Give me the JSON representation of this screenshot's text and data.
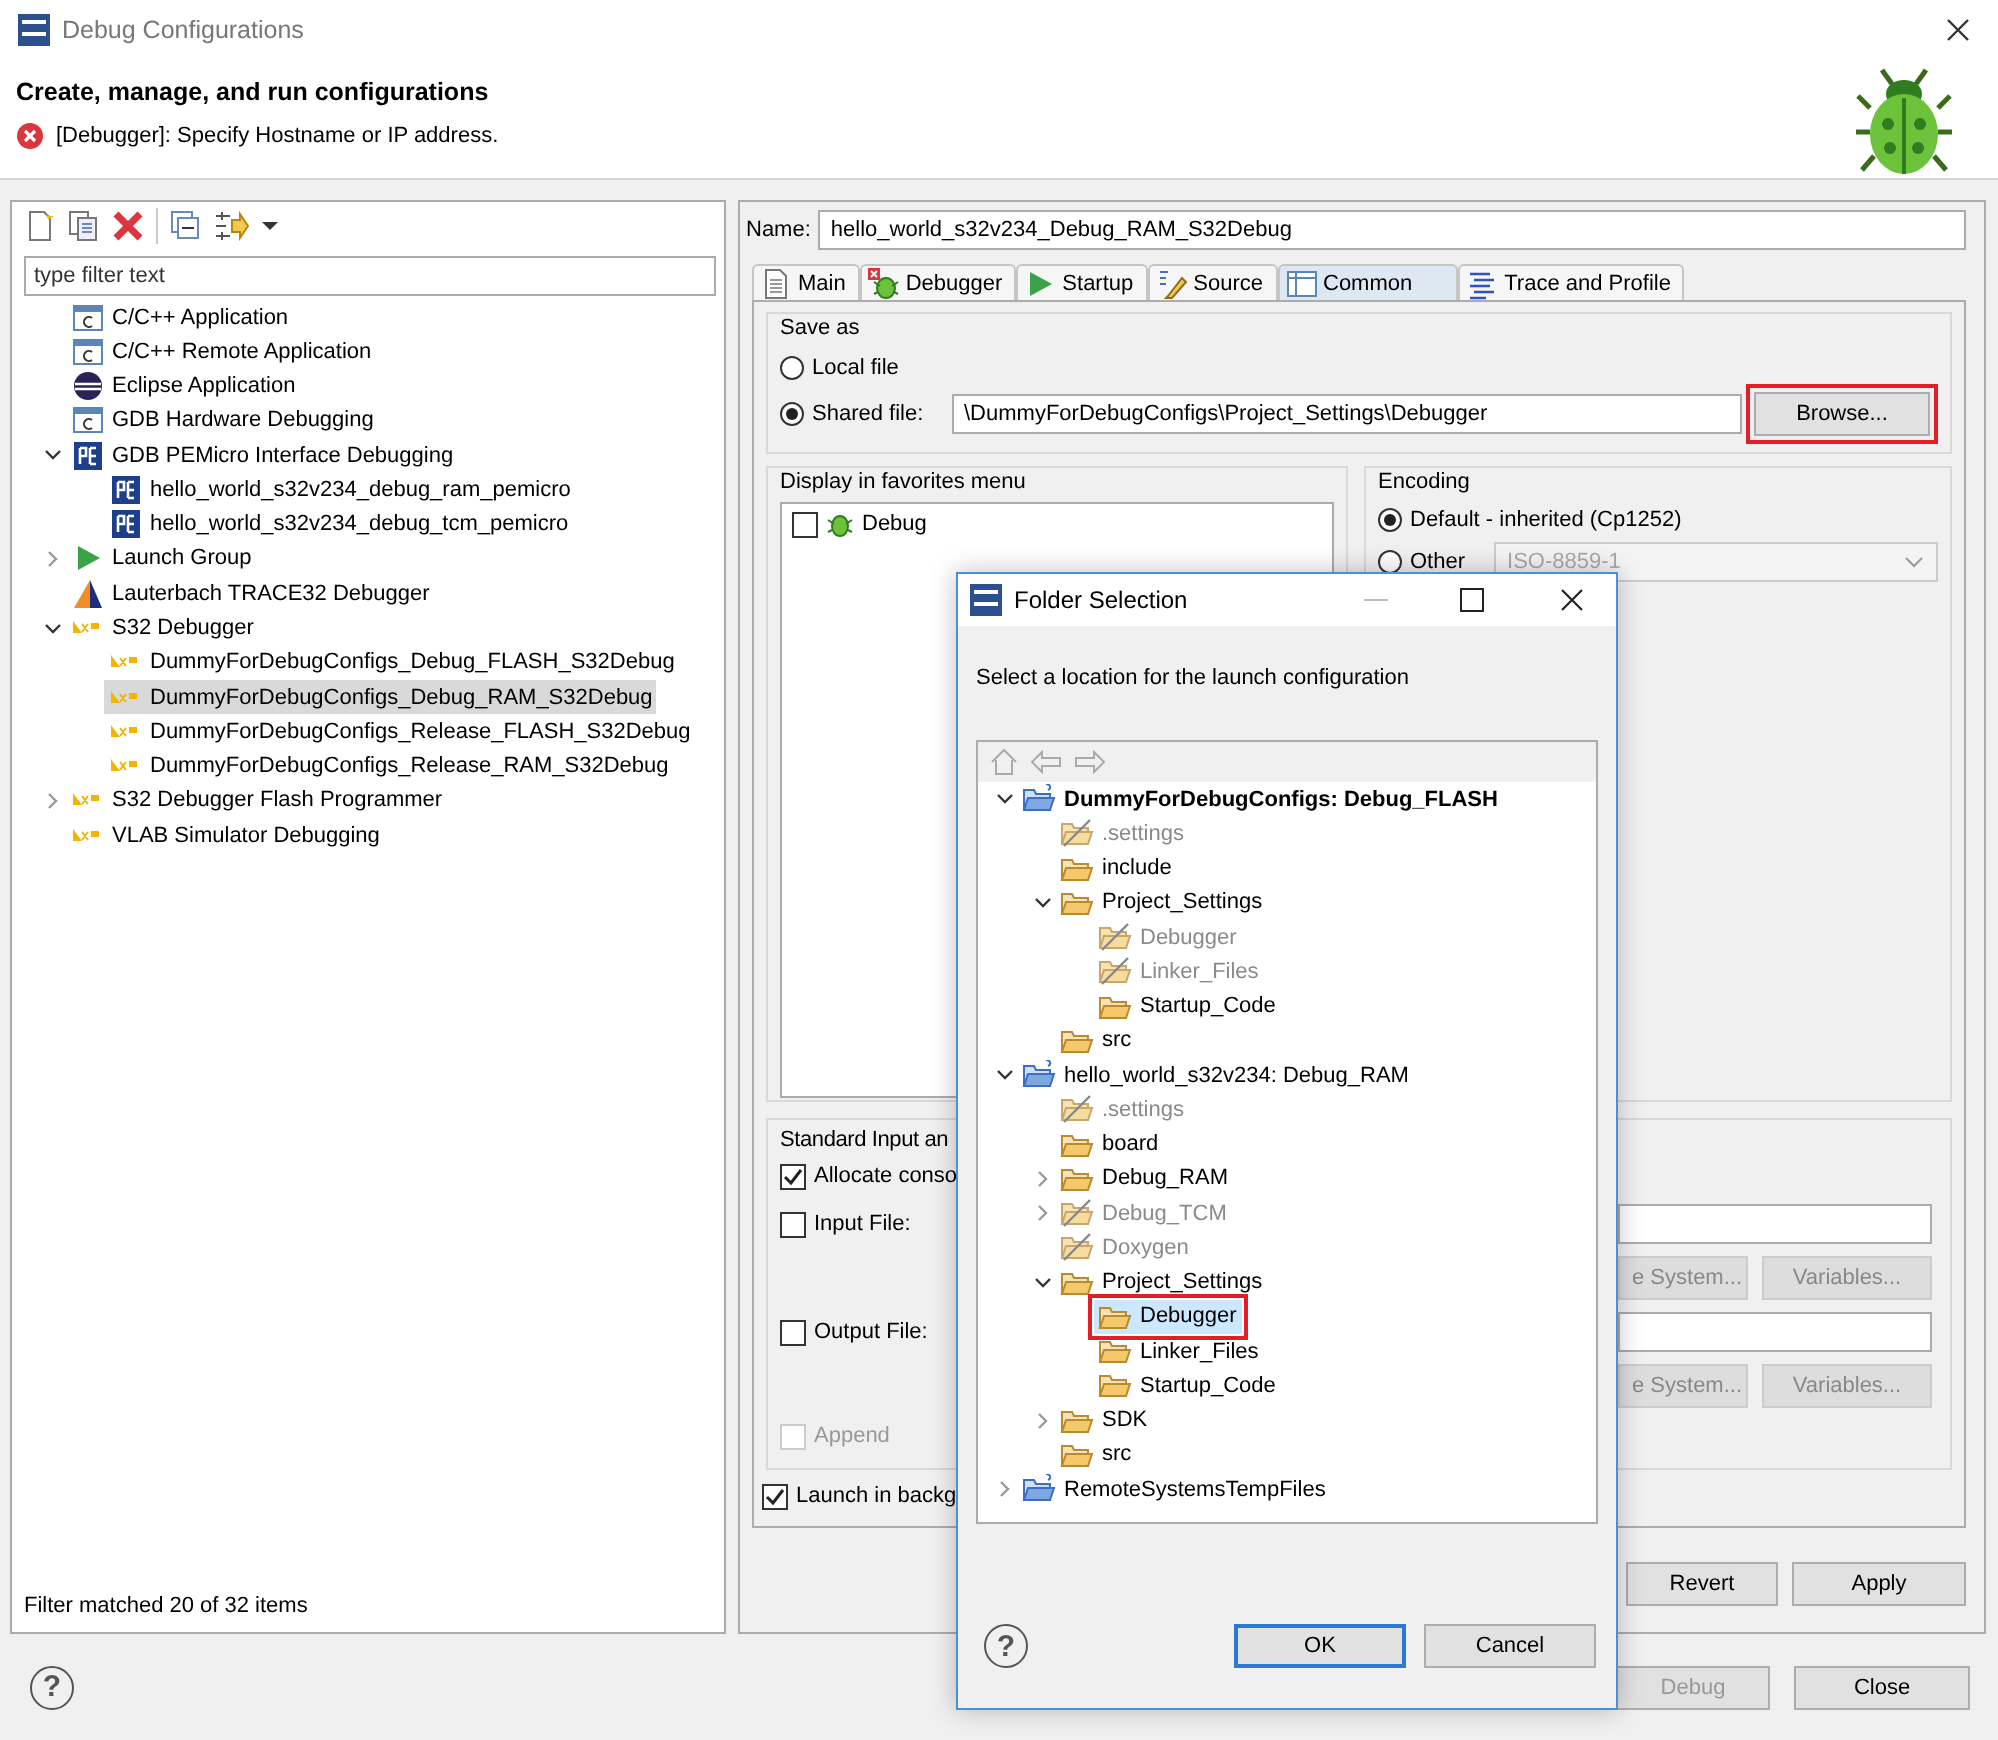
{
  "window": {
    "title": "Debug Configurations"
  },
  "header": {
    "title": "Create, manage, and run configurations",
    "message": "[Debugger]: Specify Hostname or IP address."
  },
  "configurations": {
    "filter": {
      "placeholder": "type filter text"
    },
    "tree": [
      {
        "label": "C/C++ Application",
        "kind": "c",
        "selected": false
      },
      {
        "label": "C/C++ Remote Application",
        "kind": "c",
        "selected": false
      },
      {
        "label": "Eclipse Application",
        "kind": "eclipse",
        "selected": false
      },
      {
        "label": "GDB Hardware Debugging",
        "kind": "c",
        "selected": false
      },
      {
        "label": "GDB PEMicro Interface Debugging",
        "kind": "pe",
        "selected": false,
        "expanded": true,
        "children": [
          {
            "label": "hello_world_s32v234_debug_ram_pemicro",
            "kind": "pe",
            "selected": false
          },
          {
            "label": "hello_world_s32v234_debug_tcm_pemicro",
            "kind": "pe",
            "selected": false
          }
        ]
      },
      {
        "label": "Launch Group",
        "kind": "launch",
        "selected": false,
        "expanded": false
      },
      {
        "label": "Lauterbach TRACE32 Debugger",
        "kind": "lauterbach",
        "selected": false
      },
      {
        "label": "S32 Debugger",
        "kind": "nxp",
        "selected": false,
        "expanded": true,
        "children": [
          {
            "label": "DummyForDebugConfigs_Debug_FLASH_S32Debug",
            "kind": "nxp",
            "selected": false
          },
          {
            "label": "DummyForDebugConfigs_Debug_RAM_S32Debug",
            "kind": "nxp",
            "selected": true
          },
          {
            "label": "DummyForDebugConfigs_Release_FLASH_S32Debug",
            "kind": "nxp",
            "selected": false
          },
          {
            "label": "DummyForDebugConfigs_Release_RAM_S32Debug",
            "kind": "nxp",
            "selected": false
          }
        ]
      },
      {
        "label": "S32 Debugger Flash Programmer",
        "kind": "nxp",
        "selected": false,
        "expanded": false
      },
      {
        "label": "VLAB Simulator Debugging",
        "kind": "nxp",
        "selected": false
      }
    ],
    "status": "Filter matched 20 of 32 items"
  },
  "editor": {
    "name_label": "Name:",
    "name": "hello_world_s32v234_Debug_RAM_S32Debug",
    "tabs": [
      {
        "label": "Main",
        "kind": "page",
        "selected": false
      },
      {
        "label": "Debugger",
        "kind": "bug",
        "selected": false
      },
      {
        "label": "Startup",
        "kind": "play",
        "selected": false
      },
      {
        "label": "Source",
        "kind": "source",
        "selected": false
      },
      {
        "label": "Common",
        "kind": "table",
        "selected": true
      },
      {
        "label": "Trace and Profile",
        "kind": "trace",
        "selected": false
      }
    ],
    "save_as": {
      "title": "Save as",
      "options": [
        {
          "label": "Local file",
          "selected": false
        },
        {
          "label": "Shared file:",
          "selected": true
        }
      ],
      "path": "\\DummyForDebugConfigs\\Project_Settings\\Debugger",
      "browse": {
        "label": "Browse...",
        "highlighted": true
      }
    },
    "favorites": {
      "title": "Display in favorites menu",
      "items": [
        {
          "label": "Debug",
          "checked": false
        }
      ]
    },
    "encoding": {
      "title": "Encoding",
      "options": [
        {
          "label": "Default - inherited (Cp1252)",
          "selected": true
        },
        {
          "label": "Other",
          "selected": false
        }
      ],
      "other_value": "ISO-8859-1"
    },
    "std_io": {
      "title": "Standard Input an",
      "allocate": {
        "label": "Allocate conso",
        "checked": true
      },
      "files": [
        {
          "label": "Input File:",
          "checked": false,
          "file_system": "e System...",
          "variables": "Variables..."
        },
        {
          "label": "Output File:",
          "checked": false,
          "file_system": "e System...",
          "variables": "Variables..."
        }
      ],
      "append": {
        "label": "Append",
        "checked": false,
        "disabled": true
      }
    },
    "background": {
      "label": "Launch in backg",
      "checked": true
    },
    "buttons": [
      {
        "label": "Revert"
      },
      {
        "label": "Apply"
      }
    ]
  },
  "footer": {
    "help": "?",
    "buttons": [
      {
        "label": "Debug",
        "disabled": true
      },
      {
        "label": "Close",
        "disabled": false
      }
    ]
  },
  "dialog": {
    "title": "Folder Selection",
    "message": "Select a location for the launch configuration",
    "tree": [
      {
        "label": "DummyForDebugConfigs: Debug_FLASH",
        "kind": "project",
        "current": true,
        "selected": false,
        "expanded": true,
        "children": [
          {
            "label": ".settings",
            "kind": "derived",
            "selected": false
          },
          {
            "label": "include",
            "kind": "folder",
            "selected": false
          },
          {
            "label": "Project_Settings",
            "kind": "folder",
            "selected": false,
            "expanded": true,
            "children": [
              {
                "label": "Debugger",
                "kind": "derived",
                "selected": false
              },
              {
                "label": "Linker_Files",
                "kind": "derived",
                "selected": false
              },
              {
                "label": "Startup_Code",
                "kind": "folder",
                "selected": false
              }
            ]
          },
          {
            "label": "src",
            "kind": "folder",
            "selected": false
          }
        ]
      },
      {
        "label": "hello_world_s32v234: Debug_RAM",
        "kind": "project",
        "current": false,
        "selected": false,
        "expanded": true,
        "children": [
          {
            "label": ".settings",
            "kind": "derived",
            "selected": false
          },
          {
            "label": "board",
            "kind": "folder",
            "selected": false
          },
          {
            "label": "Debug_RAM",
            "kind": "folder",
            "selected": false,
            "expanded": false
          },
          {
            "label": "Debug_TCM",
            "kind": "derived",
            "selected": false,
            "expanded": false
          },
          {
            "label": "Doxygen",
            "kind": "derived",
            "selected": false
          },
          {
            "label": "Project_Settings",
            "kind": "folder",
            "selected": false,
            "expanded": true,
            "children": [
              {
                "label": "Debugger",
                "kind": "folder",
                "selected": true,
                "highlighted": true
              },
              {
                "label": "Linker_Files",
                "kind": "folder",
                "selected": false
              },
              {
                "label": "Startup_Code",
                "kind": "folder",
                "selected": false
              }
            ]
          },
          {
            "label": "SDK",
            "kind": "folder",
            "selected": false,
            "expanded": false
          },
          {
            "label": "src",
            "kind": "folder",
            "selected": false
          }
        ]
      },
      {
        "label": "RemoteSystemsTempFiles",
        "kind": "project",
        "current": false,
        "selected": false,
        "expanded": false
      }
    ],
    "help": "?",
    "buttons": [
      {
        "label": "OK",
        "default": true
      },
      {
        "label": "Cancel",
        "default": false
      }
    ]
  }
}
